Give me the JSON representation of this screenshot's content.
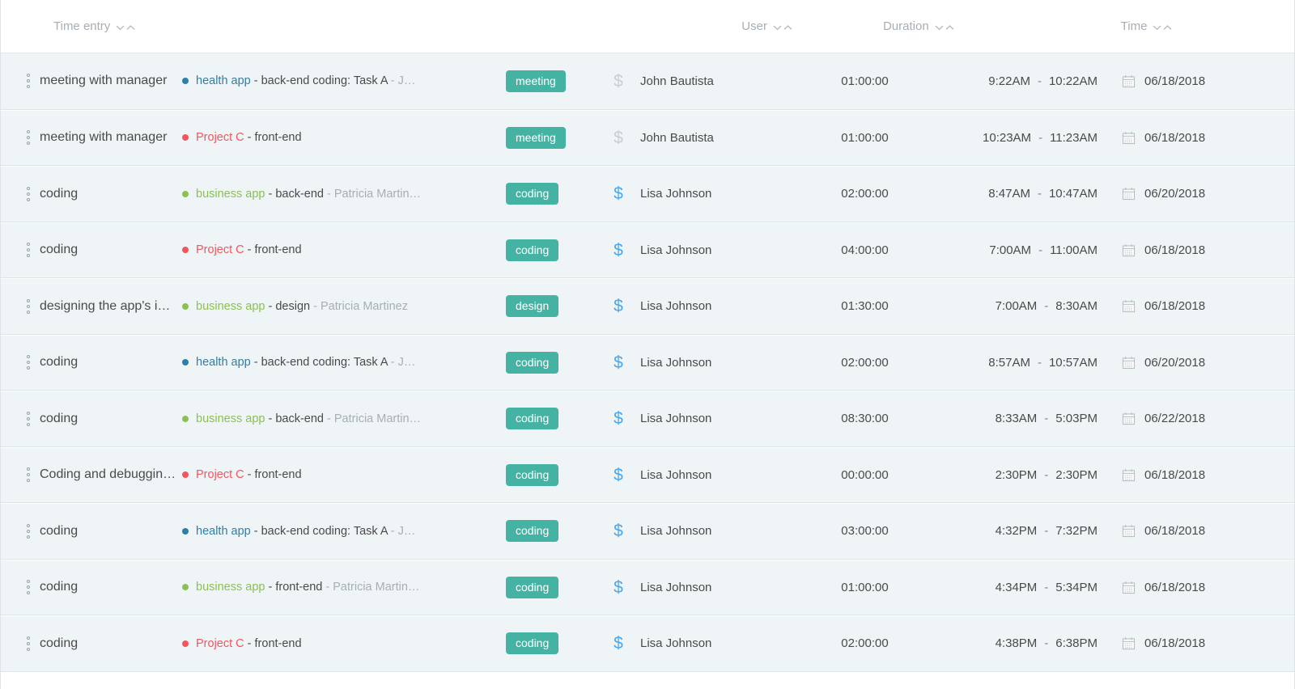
{
  "header": {
    "columns": [
      {
        "label": "Time entry",
        "name": "time-entry",
        "sortable": true
      },
      {
        "label": "User",
        "name": "user",
        "sortable": true
      },
      {
        "label": "Duration",
        "name": "duration",
        "sortable": true
      },
      {
        "label": "Time",
        "name": "time",
        "sortable": true
      }
    ],
    "sort_icons": [
      "chevron-down-icon",
      "chevron-up-icon"
    ]
  },
  "colors": {
    "tag_badge": "#45b3a3",
    "billable_active": "#4da6e8",
    "billable_inactive": "#c8ced4",
    "project_health_app": "#2d7fa8",
    "project_business_app": "#8cc152",
    "project_c": "#f4565c",
    "row_background": "#eff4f7",
    "header_text": "#a7aeb5",
    "body_text": "#4a4a4a",
    "muted_text": "#a7aeb5"
  },
  "rows": [
    {
      "description": "meeting with manager",
      "project_name": "health app",
      "project_color": "#2d7fa8",
      "task": " - back-end coding: Task A",
      "extra": " - J…",
      "tag": "meeting",
      "billable": false,
      "billable_icon": "dollar-icon",
      "user": "John Bautista",
      "duration": "01:00:00",
      "start": "9:22AM",
      "end": "10:22AM",
      "date": "06/18/2018"
    },
    {
      "description": "meeting with manager",
      "project_name": "Project C",
      "project_color": "#f4565c",
      "task": " - front-end",
      "extra": "",
      "tag": "meeting",
      "billable": false,
      "billable_icon": "dollar-icon",
      "user": "John Bautista",
      "duration": "01:00:00",
      "start": "10:23AM",
      "end": "11:23AM",
      "date": "06/18/2018"
    },
    {
      "description": "coding",
      "project_name": "business app",
      "project_color": "#8cc152",
      "task": " - back-end",
      "extra": " - Patricia Martin…",
      "tag": "coding",
      "billable": true,
      "billable_icon": "dollar-icon",
      "user": "Lisa Johnson",
      "duration": "02:00:00",
      "start": "8:47AM",
      "end": "10:47AM",
      "date": "06/20/2018"
    },
    {
      "description": "coding",
      "project_name": "Project C",
      "project_color": "#f4565c",
      "task": " - front-end",
      "extra": "",
      "tag": "coding",
      "billable": true,
      "billable_icon": "dollar-icon",
      "user": "Lisa Johnson",
      "duration": "04:00:00",
      "start": "7:00AM",
      "end": "11:00AM",
      "date": "06/18/2018"
    },
    {
      "description": "designing the app's in…",
      "project_name": "business app",
      "project_color": "#8cc152",
      "task": " - design",
      "extra": " - Patricia Martinez",
      "tag": "design",
      "billable": true,
      "billable_icon": "dollar-icon",
      "user": "Lisa Johnson",
      "duration": "01:30:00",
      "start": "7:00AM",
      "end": "8:30AM",
      "date": "06/18/2018"
    },
    {
      "description": "coding",
      "project_name": "health app",
      "project_color": "#2d7fa8",
      "task": " - back-end coding: Task A",
      "extra": " - J…",
      "tag": "coding",
      "billable": true,
      "billable_icon": "dollar-icon",
      "user": "Lisa Johnson",
      "duration": "02:00:00",
      "start": "8:57AM",
      "end": "10:57AM",
      "date": "06/20/2018"
    },
    {
      "description": "coding",
      "project_name": "business app",
      "project_color": "#8cc152",
      "task": " - back-end",
      "extra": " - Patricia Martin…",
      "tag": "coding",
      "billable": true,
      "billable_icon": "dollar-icon",
      "user": "Lisa Johnson",
      "duration": "08:30:00",
      "start": "8:33AM",
      "end": "5:03PM",
      "date": "06/22/2018"
    },
    {
      "description": "Coding and debuggin…",
      "project_name": "Project C",
      "project_color": "#f4565c",
      "task": " - front-end",
      "extra": "",
      "tag": "coding",
      "billable": true,
      "billable_icon": "dollar-icon",
      "user": "Lisa Johnson",
      "duration": "00:00:00",
      "start": "2:30PM",
      "end": "2:30PM",
      "date": "06/18/2018"
    },
    {
      "description": "coding",
      "project_name": "health app",
      "project_color": "#2d7fa8",
      "task": " - back-end coding: Task A",
      "extra": " - J…",
      "tag": "coding",
      "billable": true,
      "billable_icon": "dollar-icon",
      "user": "Lisa Johnson",
      "duration": "03:00:00",
      "start": "4:32PM",
      "end": "7:32PM",
      "date": "06/18/2018"
    },
    {
      "description": "coding",
      "project_name": "business app",
      "project_color": "#8cc152",
      "task": " - front-end",
      "extra": " - Patricia Martin…",
      "tag": "coding",
      "billable": true,
      "billable_icon": "dollar-icon",
      "user": "Lisa Johnson",
      "duration": "01:00:00",
      "start": "4:34PM",
      "end": "5:34PM",
      "date": "06/18/2018"
    },
    {
      "description": "coding",
      "project_name": "Project C",
      "project_color": "#f4565c",
      "task": " - front-end",
      "extra": "",
      "tag": "coding",
      "billable": true,
      "billable_icon": "dollar-icon",
      "user": "Lisa Johnson",
      "duration": "02:00:00",
      "start": "4:38PM",
      "end": "6:38PM",
      "date": "06/18/2018"
    }
  ],
  "symbols": {
    "billable": "$",
    "time_separator": "-"
  }
}
